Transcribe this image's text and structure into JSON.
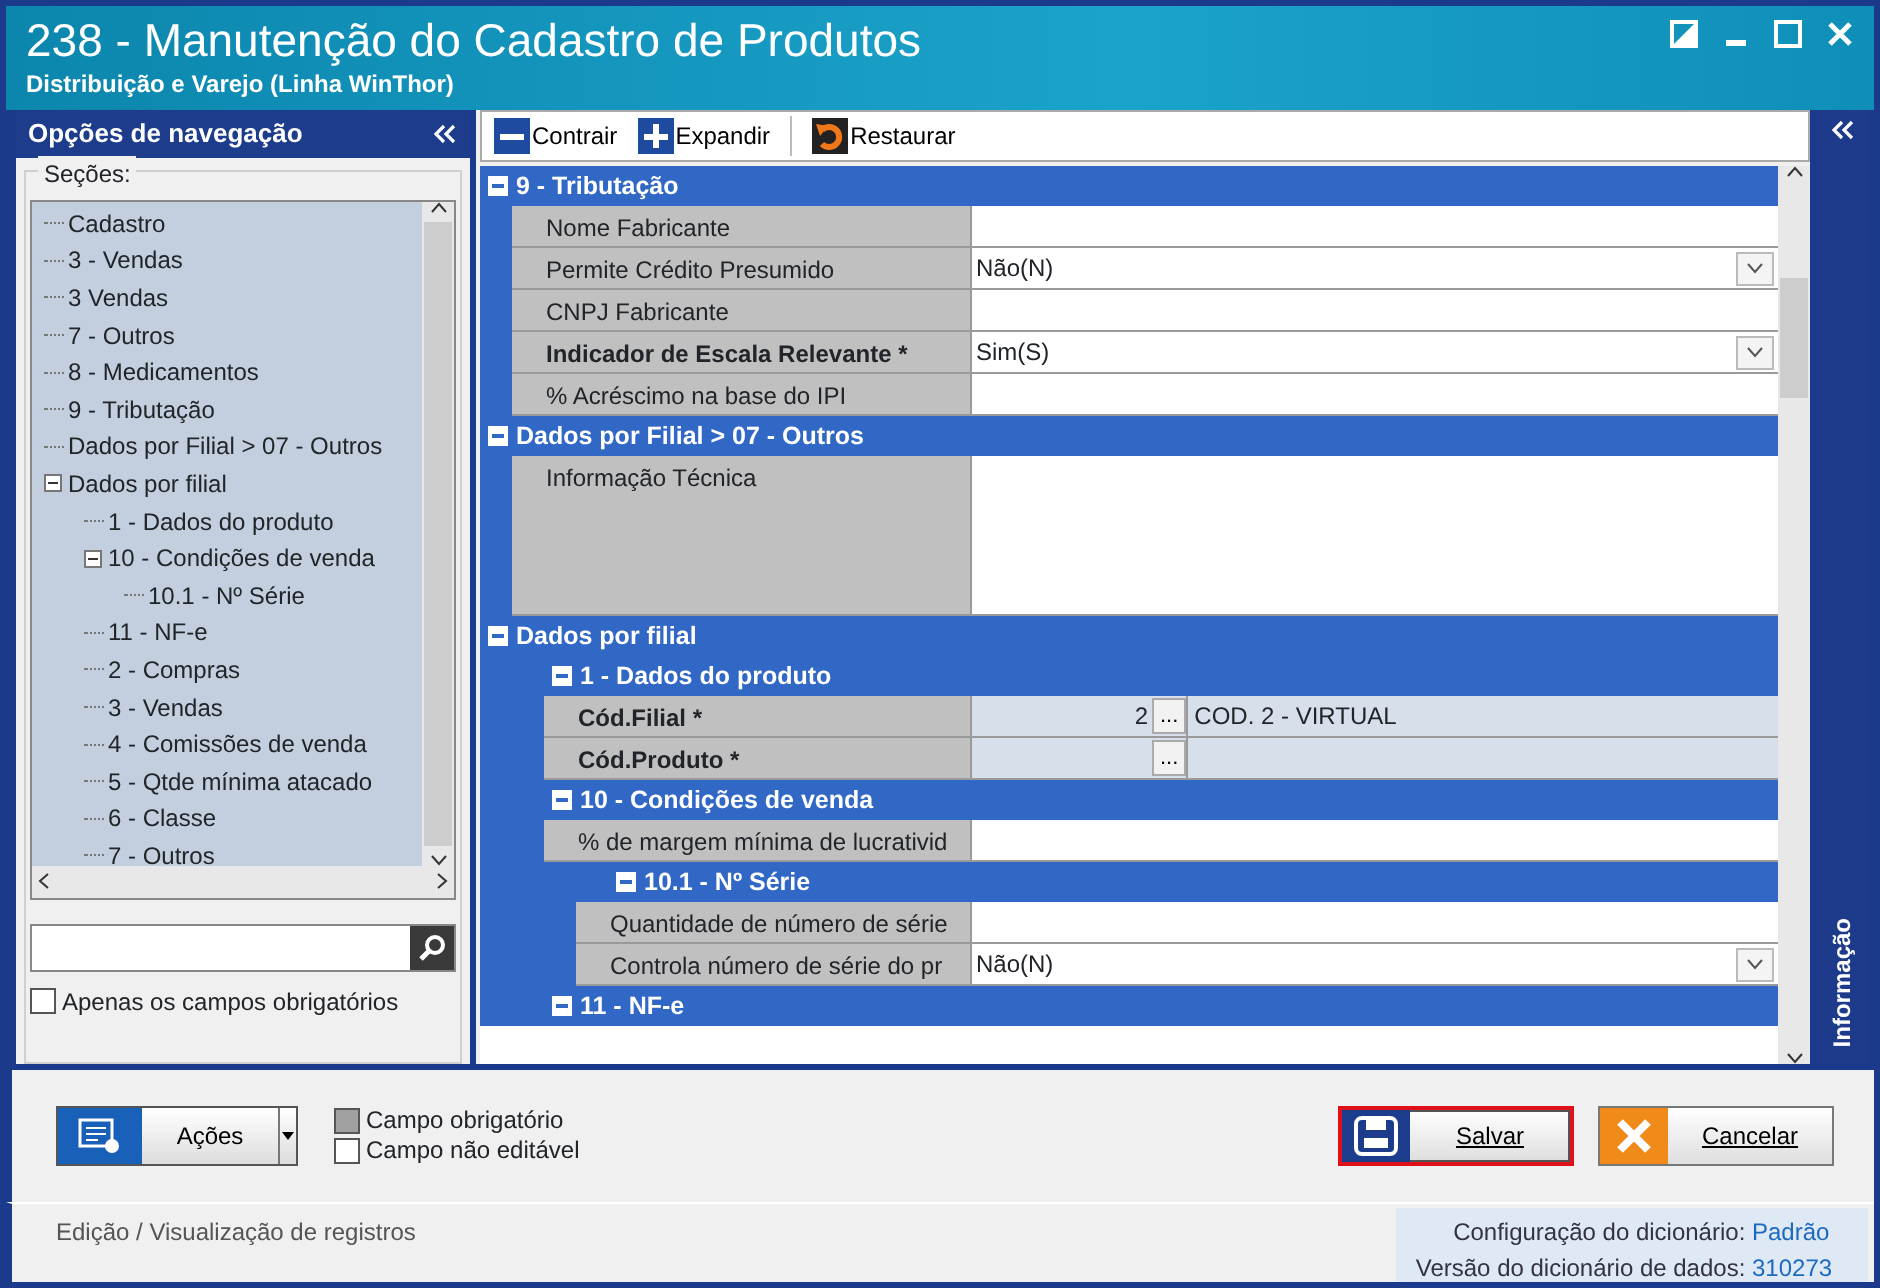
{
  "window": {
    "title": "238 - Manutenção do Cadastro de Produtos",
    "subtitle": "Distribuição e Varejo (Linha WinThor)"
  },
  "navigation": {
    "title": "Opções de navegação",
    "sections_label": "Seções:",
    "tree": [
      {
        "label": "Cadastro"
      },
      {
        "label": "3 - Vendas"
      },
      {
        "label": "3 Vendas"
      },
      {
        "label": "7 - Outros"
      },
      {
        "label": "8 - Medicamentos"
      },
      {
        "label": "9 - Tributação"
      },
      {
        "label": "Dados por Filial > 07 - Outros"
      },
      {
        "label": "Dados por filial",
        "expanded": true,
        "children": [
          {
            "label": "1 - Dados do produto"
          },
          {
            "label": "10 - Condições de venda",
            "expanded": true,
            "children": [
              {
                "label": "10.1 - Nº Série"
              }
            ]
          },
          {
            "label": "11 - NF-e"
          },
          {
            "label": "2 - Compras"
          },
          {
            "label": "3 - Vendas"
          },
          {
            "label": "4 - Comissões de venda"
          },
          {
            "label": "5 - Qtde mínima atacado"
          },
          {
            "label": "6 - Classe"
          },
          {
            "label": "7 - Outros"
          }
        ]
      }
    ],
    "only_required": {
      "label": "Apenas os campos obrigatórios",
      "checked": false
    }
  },
  "toolbar": [
    {
      "kind": "collapse",
      "label": "Contrair"
    },
    {
      "kind": "expand",
      "label": "Expandir"
    },
    {
      "kind": "restore",
      "label": "Restaurar"
    }
  ],
  "grid": [
    {
      "title": "9 - Tributação",
      "expanded": true,
      "rows": [
        {
          "label": "Nome Fabricante",
          "bold": false,
          "kind": "text",
          "value": ""
        },
        {
          "label": "Permite Crédito Presumido",
          "bold": false,
          "kind": "dropdown",
          "value": "Não(N)"
        },
        {
          "label": "CNPJ Fabricante",
          "bold": false,
          "kind": "text",
          "value": ""
        },
        {
          "label": "Indicador de Escala Relevante *",
          "bold": true,
          "kind": "dropdown",
          "value": "Sim(S)"
        },
        {
          "label": "% Acréscimo na base do IPI",
          "bold": false,
          "kind": "text",
          "value": ""
        }
      ]
    },
    {
      "title": "Dados por Filial > 07 - Outros",
      "expanded": true,
      "rows": [
        {
          "label": "Informação Técnica",
          "bold": false,
          "kind": "memo",
          "value": ""
        }
      ]
    },
    {
      "title": "Dados por filial",
      "expanded": true,
      "sections": [
        {
          "title": "1 - Dados do produto",
          "expanded": true,
          "rows": [
            {
              "label": "Cód.Filial *",
              "bold": true,
              "kind": "lookup",
              "value": "2",
              "button": "...",
              "description": "COD. 2 - VIRTUAL"
            },
            {
              "label": "Cód.Produto *",
              "bold": true,
              "kind": "lookup",
              "value": "",
              "button": "...",
              "description": ""
            }
          ]
        },
        {
          "title": "10 - Condições de venda",
          "expanded": true,
          "rows": [
            {
              "label": "% de margem mínima de lucrativid",
              "bold": false,
              "kind": "text",
              "value": ""
            }
          ],
          "sections": [
            {
              "title": "10.1 - Nº Série",
              "expanded": true,
              "rows": [
                {
                  "label": "Quantidade de número de série",
                  "bold": false,
                  "kind": "text",
                  "value": ""
                },
                {
                  "label": "Controla número de série do pr",
                  "bold": false,
                  "kind": "dropdown",
                  "value": "Não(N)"
                }
              ]
            }
          ]
        },
        {
          "title": "11 - NF-e",
          "expanded": true
        }
      ]
    }
  ],
  "info_panel": {
    "title": "Informação"
  },
  "actions_button": {
    "label": "Ações"
  },
  "legend": [
    {
      "label": "Campo obrigatório",
      "color": "#a0a0a0"
    },
    {
      "label": "Campo não editável",
      "color": "#ffffff"
    }
  ],
  "buttons": [
    {
      "kind": "save",
      "label": "Salvar",
      "highlighted": true
    },
    {
      "kind": "cancel",
      "label": "Cancelar",
      "highlighted": false
    }
  ],
  "status_bar": {
    "text": "Edição / Visualização de registros",
    "info": [
      {
        "label": "Configuração do dicionário:",
        "value": "Padrão"
      },
      {
        "label": "Versão do dicionário de dados:",
        "value": "310273"
      }
    ]
  }
}
